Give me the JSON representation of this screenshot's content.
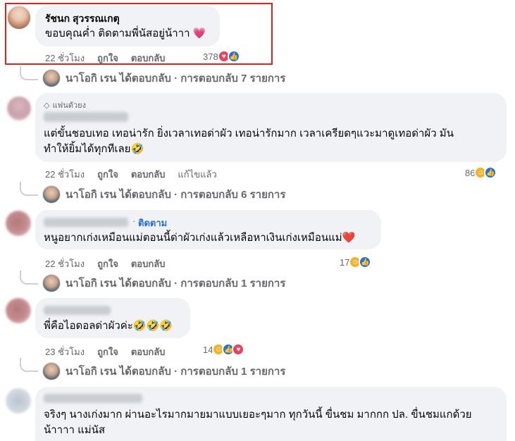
{
  "comments": [
    {
      "author": "รัชนก สุวรรณเกตุ",
      "text": "ขอบคุณค่ำ ติดตามพี่นัสอยู่น้าาา 💗",
      "time": "22 ชั่วโมง",
      "like": "ถูกใจ",
      "reply": "ตอบกลับ",
      "reaction_count": "378",
      "reactions": [
        "love-icon",
        "like-icon"
      ],
      "reply_summary": "นาโอกิ เรน ได้ตอบกลับ · การตอบกลับ 7 รายการ"
    },
    {
      "badge": "แฟนตัวยง",
      "text_line1": "แต่ขั้นชอบเทอ เทอน่ารัก ยิ่งเวลาเทอด่าผัว เทอน่ารักมาก เวลาเครียดๆแวะมาดูเทอด่าผัว มัน",
      "text_line2": "ทำให้ยิ้มได้ทุกทีเลย🤣",
      "time": "22 ชั่วโมง",
      "like": "ถูกใจ",
      "reply": "ตอบกลับ",
      "edited": "แก้ไขแล้ว",
      "reaction_count": "86",
      "reactions": [
        "haha-icon",
        "like-icon"
      ],
      "reply_summary": "นาโอกิ เรน ได้ตอบกลับ · การตอบกลับ 6 รายการ"
    },
    {
      "follow": "ติดตาม",
      "text": "หนูอยากเก่งเหมือนแม่ตอนนี้ด่าผัวเก่งแล้วเหลือหาเงินเก่งเหมือนแม่❤️",
      "time": "22 ชั่วโมง",
      "like": "ถูกใจ",
      "reply": "ตอบกลับ",
      "reaction_count": "17",
      "reactions": [
        "haha-icon",
        "like-icon"
      ],
      "reply_summary": "นาโอกิ เรน ได้ตอบกลับ · การตอบกลับ 1 รายการ"
    },
    {
      "text": "พี่คือไอดอลด่าผัวค่ะ🤣🤣🤣",
      "time": "23 ชั่วโมง",
      "like": "ถูกใจ",
      "reply": "ตอบกลับ",
      "reaction_count": "14",
      "reactions": [
        "haha-icon",
        "like-icon",
        "love-icon"
      ],
      "reply_summary": "นาโอกิ เรน ได้ตอบกลับ · การตอบกลับ 1 รายการ"
    },
    {
      "text_line1": "จริงๆ นางเก่งมาก ผ่านอะไรมากมายมาแบบเยอะๆมาก ทุกวันนี้ ขื่นชม มากกก ปล. ขื่นชมแกด้วย",
      "text_line2": "น้าาาา แม่นัส"
    }
  ],
  "colors": {
    "highlight": "#e2231a",
    "bubble": "#f0f2f5",
    "meta": "#65676b",
    "link": "#216fdb"
  }
}
